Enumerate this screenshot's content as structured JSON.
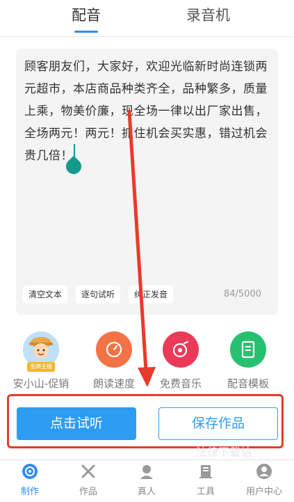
{
  "tabs": [
    {
      "label": "配音"
    },
    {
      "label": "录音机"
    }
  ],
  "editor": {
    "text": "顾客朋友们，大家好，欢迎光临新时尚连锁两元超市，本店商品种类齐全，品种繁多，质量上乘，物美价廉，现全场一律以出厂家出售，全场两元！两元！抓住机会买实惠，错过机会贵几倍！",
    "chips": [
      "清空文本",
      "逐句试听",
      "纠正发音"
    ],
    "counter": "84/5000"
  },
  "actions": [
    {
      "label": "安小山-促销",
      "icon": "avatar-icon",
      "badge": "金牌主播"
    },
    {
      "label": "朗读速度",
      "icon": "speedometer-icon",
      "color": "#f47346"
    },
    {
      "label": "免费音乐",
      "icon": "music-disc-icon",
      "color": "#ea3a58"
    },
    {
      "label": "配音模板",
      "icon": "document-icon",
      "color": "#27c070"
    }
  ],
  "buttons": {
    "listen": "点击试听",
    "save": "保存作品"
  },
  "watermark": "法律下载站",
  "nav": [
    {
      "label": "制作",
      "icon": "make-icon",
      "active": true
    },
    {
      "label": "作品",
      "icon": "works-icon"
    },
    {
      "label": "真人",
      "icon": "person-icon"
    },
    {
      "label": "工具",
      "icon": "tools-icon"
    },
    {
      "label": "用户中心",
      "icon": "user-center-icon"
    }
  ],
  "colors": {
    "accent": "#2f9cf3",
    "highlight": "#e83a2a",
    "cursor": "#129a8e"
  }
}
